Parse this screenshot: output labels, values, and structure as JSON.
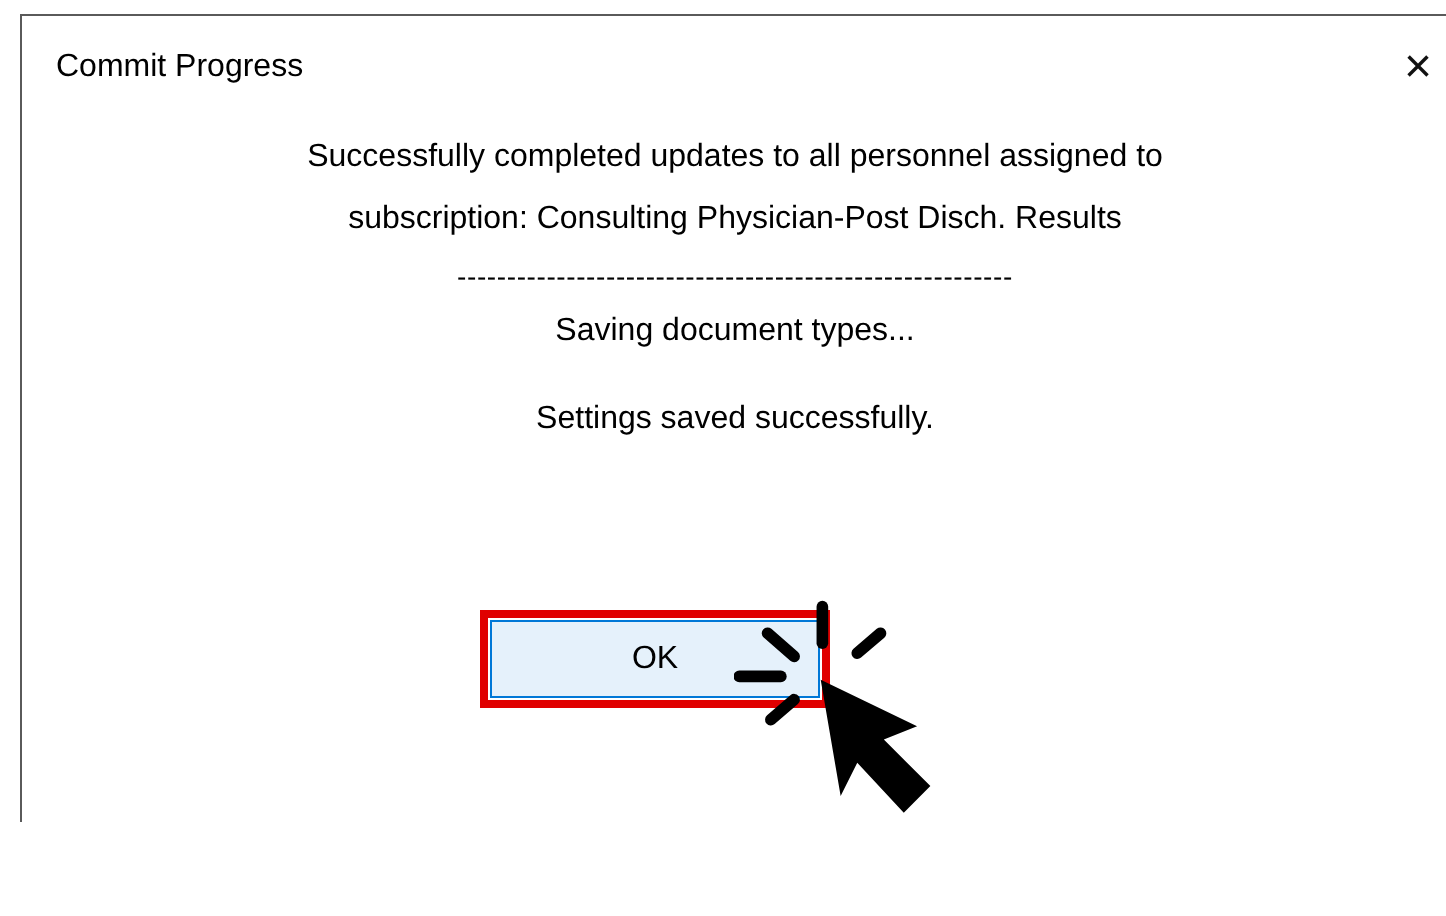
{
  "window": {
    "title": "Commit Progress",
    "close": "×"
  },
  "messages": [
    "Successfully completed updates to all personnel assigned to subscription: Consulting Physician-Post Disch. Results",
    "--------------------------------------------------------",
    "Saving document types...",
    "Settings saved successfully."
  ],
  "buttons": [
    {
      "label": "OK",
      "focused": true
    }
  ]
}
